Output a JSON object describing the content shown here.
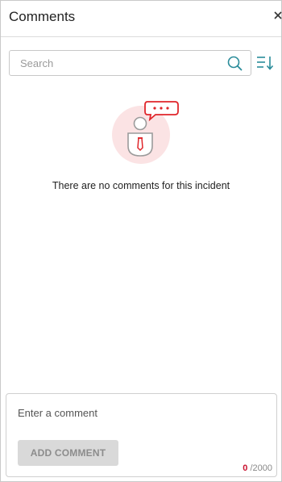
{
  "header": {
    "title": "Comments",
    "close_icon": "close-icon"
  },
  "search": {
    "placeholder": "Search",
    "value": "",
    "icon": "search-icon"
  },
  "sort": {
    "icon": "sort-icon"
  },
  "empty_state": {
    "icon": "no-comments-icon",
    "message": "There are no comments for this incident"
  },
  "composer": {
    "placeholder": "Enter a comment",
    "value": "",
    "button_label": "ADD COMMENT",
    "char_count": "0",
    "char_limit": "/2000"
  },
  "colors": {
    "accent": "#2a8c9a",
    "alert_red": "#e0262b",
    "illustration_bg": "#fbe3e4",
    "button_disabled_bg": "#d9d9d9",
    "counter_red": "#c8102e"
  }
}
